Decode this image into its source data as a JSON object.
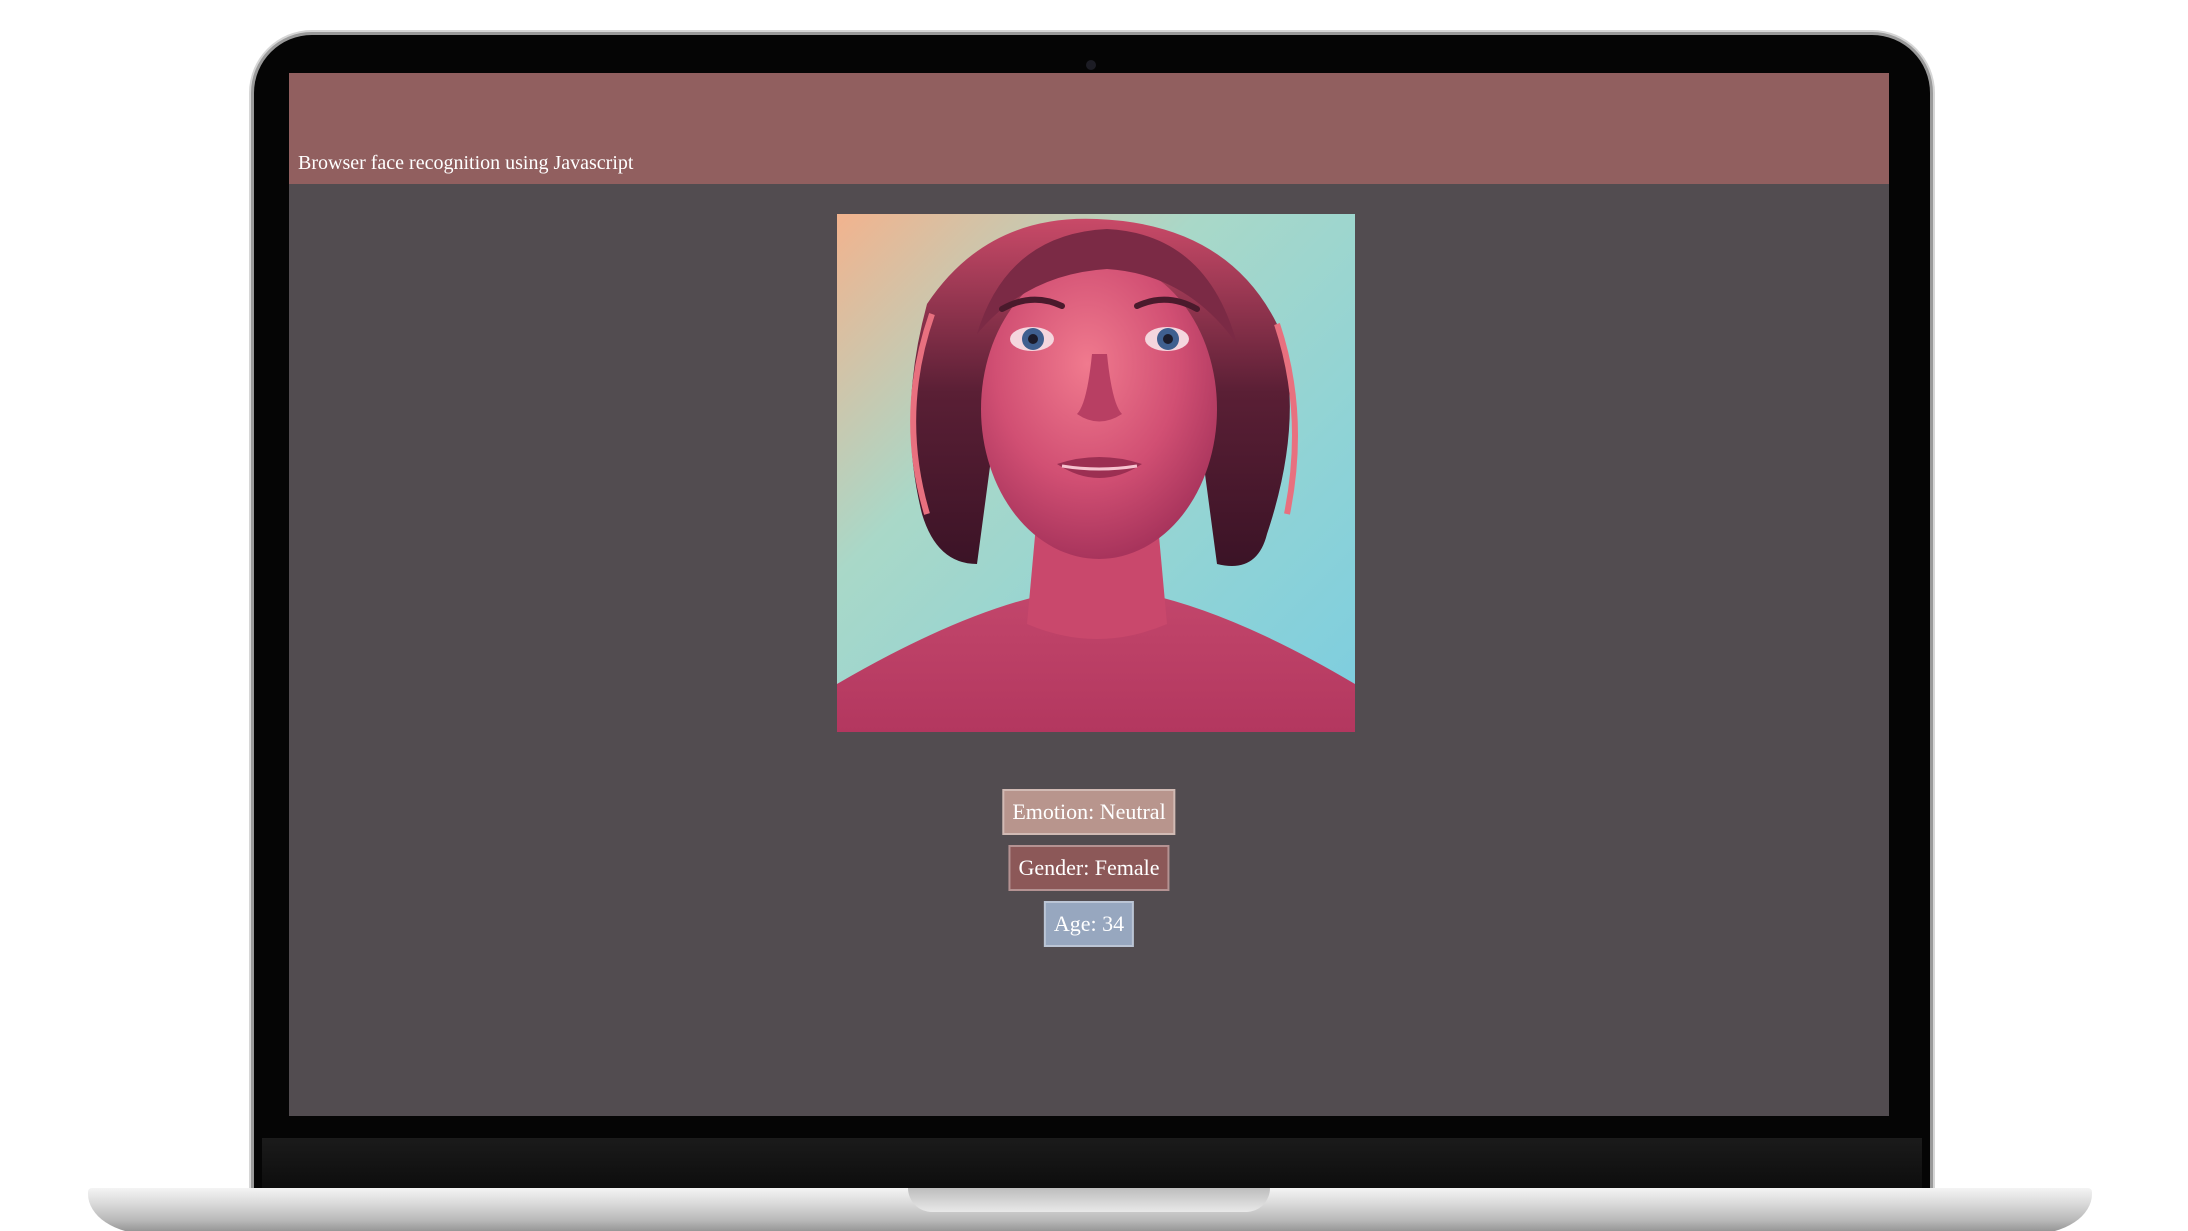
{
  "page": {
    "title": "Browser face recognition using Javascript"
  },
  "portrait": {
    "icon": "portrait-image"
  },
  "results": {
    "emotion": "Emotion: Neutral",
    "gender": "Gender: Female",
    "age": "Age: 34"
  },
  "colors": {
    "header_bg": "#915f5f",
    "page_bg": "#524c50",
    "emotion_badge": "#b8958d",
    "gender_badge": "#8c5858",
    "age_badge": "#97a7bf"
  }
}
